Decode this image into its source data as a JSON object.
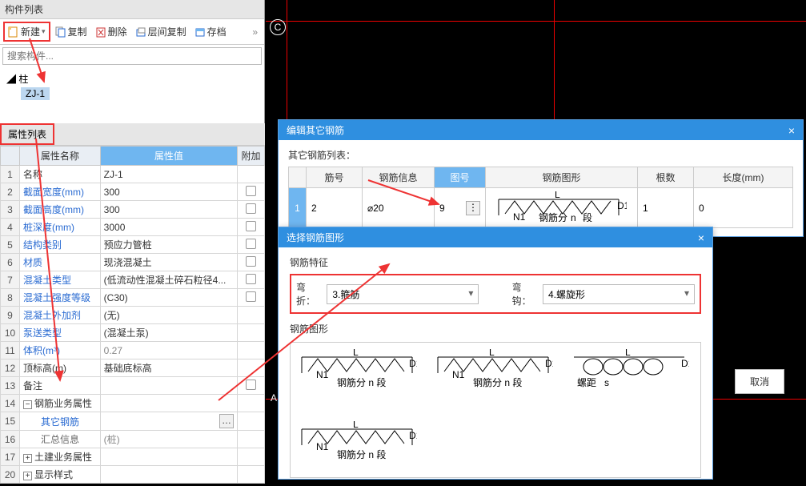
{
  "component_panel": {
    "title": "构件列表",
    "toolbar": {
      "new": "新建",
      "copy": "复制",
      "delete": "删除",
      "layer_copy": "层间复制",
      "archive": "存档"
    },
    "search_placeholder": "搜索构件...",
    "tree": {
      "root": "柱",
      "leaf": "ZJ-1"
    }
  },
  "prop_panel": {
    "title": "属性列表",
    "headers": {
      "name": "属性名称",
      "value": "属性值",
      "extra": "附加"
    },
    "rows": [
      {
        "n": "1",
        "name": "名称",
        "val": "ZJ-1",
        "chk": false
      },
      {
        "n": "2",
        "name": "截面宽度(mm)",
        "val": "300",
        "chk": true,
        "link": true
      },
      {
        "n": "3",
        "name": "截面高度(mm)",
        "val": "300",
        "chk": true,
        "link": true
      },
      {
        "n": "4",
        "name": "桩深度(mm)",
        "val": "3000",
        "chk": true,
        "link": true
      },
      {
        "n": "5",
        "name": "结构类别",
        "val": "预应力管桩",
        "chk": true,
        "link": true
      },
      {
        "n": "6",
        "name": "材质",
        "val": "现浇混凝土",
        "chk": true,
        "link": true
      },
      {
        "n": "7",
        "name": "混凝土类型",
        "val": "(低流动性混凝土碎石粒径4...",
        "chk": true,
        "link": true
      },
      {
        "n": "8",
        "name": "混凝土强度等级",
        "val": "(C30)",
        "chk": true,
        "link": true
      },
      {
        "n": "9",
        "name": "混凝土外加剂",
        "val": "(无)",
        "chk": false,
        "link": true
      },
      {
        "n": "10",
        "name": "泵送类型",
        "val": "(混凝土泵)",
        "chk": false,
        "link": true
      },
      {
        "n": "11",
        "name": "体积(m³)",
        "val": "0.27",
        "chk": false,
        "link": true,
        "gray": true
      },
      {
        "n": "12",
        "name": "顶标高(m)",
        "val": "基础底标高",
        "chk": false
      },
      {
        "n": "13",
        "name": "备注",
        "val": "",
        "chk": true
      },
      {
        "n": "14",
        "name": "钢筋业务属性",
        "val": "",
        "group": true,
        "minus": true
      },
      {
        "n": "15",
        "name": "其它钢筋",
        "val": "",
        "indent": true,
        "ellipsis": true,
        "link": true
      },
      {
        "n": "16",
        "name": "汇总信息",
        "val": "(桩)",
        "indent": true,
        "gray": true
      },
      {
        "n": "17",
        "name": "土建业务属性",
        "val": "",
        "group": true
      },
      {
        "n": "20",
        "name": "显示样式",
        "val": "",
        "group": true
      }
    ]
  },
  "rebar_dialog": {
    "title": "编辑其它钢筋",
    "list_label": "其它钢筋列表：",
    "headers": {
      "code": "筋号",
      "info": "钢筋信息",
      "figno": "图号",
      "shape": "钢筋图形",
      "count": "根数",
      "length": "长度(mm)"
    },
    "row": {
      "n": "1",
      "code": "2",
      "info": "⌀20",
      "figno": "9",
      "count": "1",
      "length": "0"
    },
    "shape_labels": {
      "L": "L",
      "N1": "N1",
      "D1": "D1",
      "segtext": "钢筋分",
      "n": "n",
      "seg": "段"
    }
  },
  "shape_dialog": {
    "title": "选择钢筋图形",
    "feat_label": "钢筋特征",
    "bend_label": "弯折：",
    "bend_value": "3.箍筋",
    "hook_label": "弯钩：",
    "hook_value": "4.螺旋形",
    "shape_label": "钢筋图形",
    "spiral": "螺距"
  },
  "cancel": "取消"
}
